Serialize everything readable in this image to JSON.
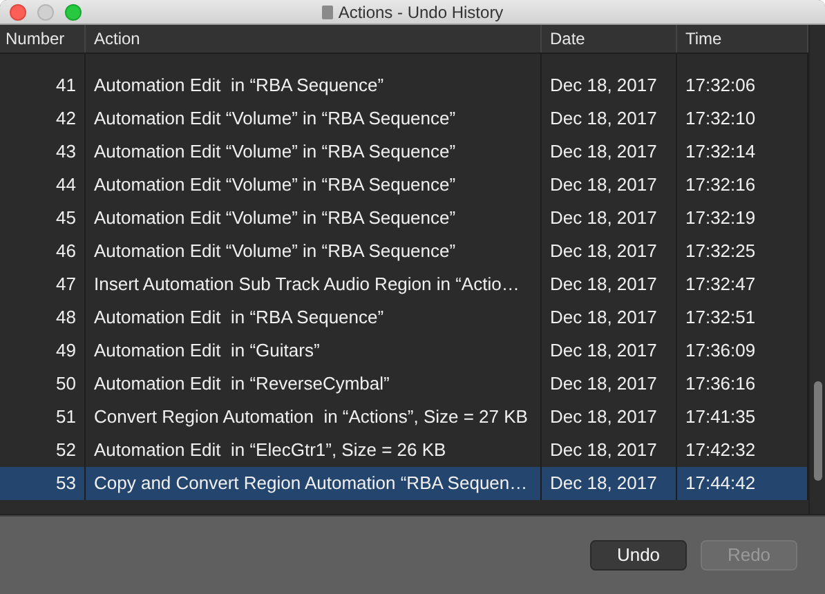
{
  "window": {
    "title": "Actions - Undo History"
  },
  "table": {
    "columns": [
      "Number",
      "Action",
      "Date",
      "Time"
    ],
    "rows": [
      {
        "number": "41",
        "action": "Automation Edit  in “RBA Sequence”",
        "date": "Dec 18, 2017",
        "time": "17:32:06",
        "selected": false
      },
      {
        "number": "42",
        "action": "Automation Edit “Volume” in “RBA Sequence”",
        "date": "Dec 18, 2017",
        "time": "17:32:10",
        "selected": false
      },
      {
        "number": "43",
        "action": "Automation Edit “Volume” in “RBA Sequence”",
        "date": "Dec 18, 2017",
        "time": "17:32:14",
        "selected": false
      },
      {
        "number": "44",
        "action": "Automation Edit “Volume” in “RBA Sequence”",
        "date": "Dec 18, 2017",
        "time": "17:32:16",
        "selected": false
      },
      {
        "number": "45",
        "action": "Automation Edit “Volume” in “RBA Sequence”",
        "date": "Dec 18, 2017",
        "time": "17:32:19",
        "selected": false
      },
      {
        "number": "46",
        "action": "Automation Edit “Volume” in “RBA Sequence”",
        "date": "Dec 18, 2017",
        "time": "17:32:25",
        "selected": false
      },
      {
        "number": "47",
        "action": "Insert Automation Sub Track Audio Region in “Actio…",
        "date": "Dec 18, 2017",
        "time": "17:32:47",
        "selected": false
      },
      {
        "number": "48",
        "action": "Automation Edit  in “RBA Sequence”",
        "date": "Dec 18, 2017",
        "time": "17:32:51",
        "selected": false
      },
      {
        "number": "49",
        "action": "Automation Edit  in “Guitars”",
        "date": "Dec 18, 2017",
        "time": "17:36:09",
        "selected": false
      },
      {
        "number": "50",
        "action": "Automation Edit  in “ReverseCymbal”",
        "date": "Dec 18, 2017",
        "time": "17:36:16",
        "selected": false
      },
      {
        "number": "51",
        "action": "Convert Region Automation  in “Actions”, Size = 27 KB",
        "date": "Dec 18, 2017",
        "time": "17:41:35",
        "selected": false
      },
      {
        "number": "52",
        "action": "Automation Edit  in “ElecGtr1”, Size = 26 KB",
        "date": "Dec 18, 2017",
        "time": "17:42:32",
        "selected": false
      },
      {
        "number": "53",
        "action": "Copy and Convert Region Automation “RBA Sequen…",
        "date": "Dec 18, 2017",
        "time": "17:44:42",
        "selected": true
      }
    ]
  },
  "buttons": [
    {
      "label": "Undo",
      "disabled": false
    },
    {
      "label": "Redo",
      "disabled": true
    }
  ]
}
